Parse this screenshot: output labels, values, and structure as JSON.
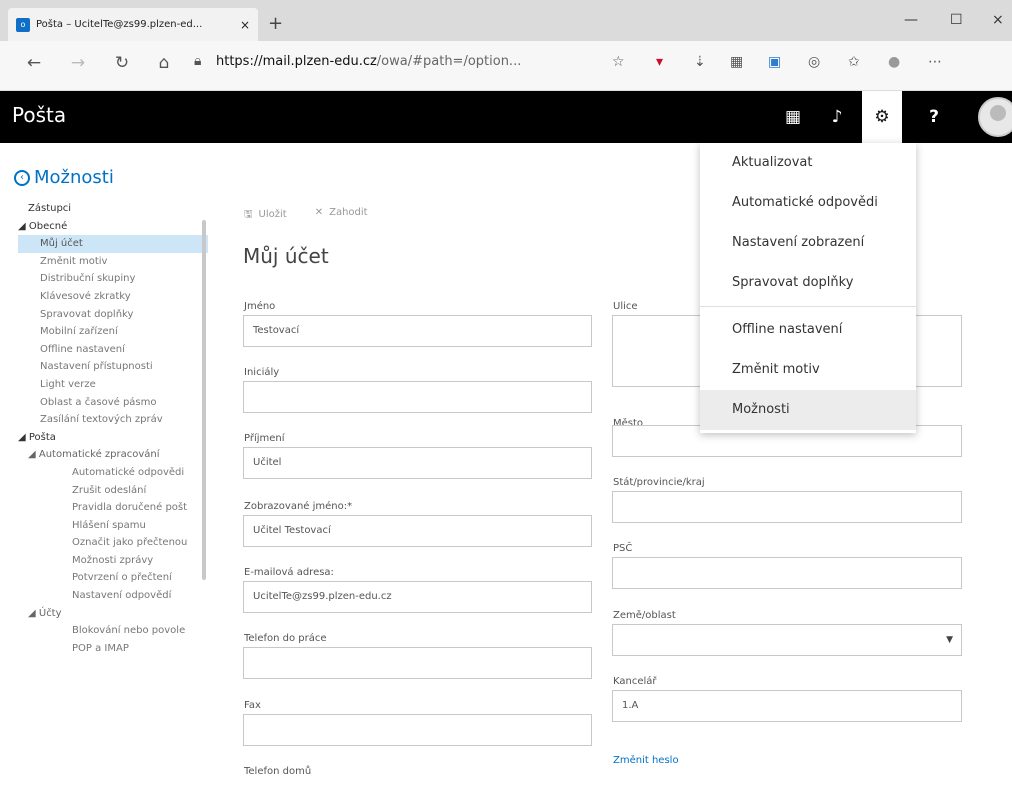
{
  "browser": {
    "tab_favicon": "o",
    "tab_title": "Pošta – UcitelTe@zs99.plzen-ed...",
    "tab_close": "×",
    "new_tab": "+",
    "url_host": "https://mail.plzen-edu.cz",
    "url_path": "/owa/#path=/option...",
    "win_min": "—",
    "win_max": "☐",
    "win_close": "×"
  },
  "header": {
    "app_name": "Pošta"
  },
  "sidebar": {
    "back_label": "Možnosti",
    "items": [
      {
        "label": "Zástupci",
        "level": "l0"
      },
      {
        "label": "◢ Obecné",
        "level": "h"
      },
      {
        "label": "Můj účet",
        "level": "l1",
        "selected": true
      },
      {
        "label": "Změnit motiv",
        "level": "l1"
      },
      {
        "label": "Distribuční skupiny",
        "level": "l1"
      },
      {
        "label": "Klávesové zkratky",
        "level": "l1"
      },
      {
        "label": "Spravovat doplňky",
        "level": "l1"
      },
      {
        "label": "Mobilní zařízení",
        "level": "l1"
      },
      {
        "label": "Offline nastavení",
        "level": "l1"
      },
      {
        "label": "Nastavení přístupnosti",
        "level": "l1"
      },
      {
        "label": "Light verze",
        "level": "l1"
      },
      {
        "label": "Oblast a časové pásmo",
        "level": "l1"
      },
      {
        "label": "Zasílání textových zpráv",
        "level": "l1"
      },
      {
        "label": "◢ Pošta",
        "level": "h"
      },
      {
        "label": "◢ Automatické zpracování",
        "level": "l1h"
      },
      {
        "label": "Automatické odpovědi",
        "level": "l3"
      },
      {
        "label": "Zrušit odeslání",
        "level": "l3"
      },
      {
        "label": "Pravidla doručené pošt",
        "level": "l3"
      },
      {
        "label": "Hlášení spamu",
        "level": "l3"
      },
      {
        "label": "Označit jako přečtenou",
        "level": "l3"
      },
      {
        "label": "Možnosti zprávy",
        "level": "l3"
      },
      {
        "label": "Potvrzení o přečtení",
        "level": "l3"
      },
      {
        "label": "Nastavení odpovědí",
        "level": "l3"
      },
      {
        "label": "◢ Účty",
        "level": "l1h"
      },
      {
        "label": "Blokování nebo povole",
        "level": "l3"
      },
      {
        "label": "POP a IMAP",
        "level": "l3"
      }
    ]
  },
  "toolbar": {
    "save_label": "Uložit",
    "discard_label": "Zahodit"
  },
  "form": {
    "title": "Můj účet",
    "left": [
      {
        "label": "Jméno",
        "value": ""
      },
      {
        "label": "Iniciály",
        "value": ""
      },
      {
        "label": "Příjmení",
        "value": "Učitel"
      },
      {
        "label": "Zobrazované jméno:*",
        "value": "Učitel Testovací"
      },
      {
        "label": "E-mailová adresa:",
        "value": "UcitelTe@zs99.plzen-edu.cz"
      },
      {
        "label": "Telefon do práce",
        "value": ""
      },
      {
        "label": "Fax",
        "value": ""
      },
      {
        "label": "Telefon domů",
        "value": ""
      }
    ],
    "first_name_value": "Testovací",
    "right": [
      {
        "label": "Ulice",
        "value": ""
      },
      {
        "label": "Město",
        "value": ""
      },
      {
        "label": "Stát/provincie/kraj",
        "value": ""
      },
      {
        "label": "PSČ",
        "value": ""
      },
      {
        "label": "Země/oblast",
        "value": ""
      },
      {
        "label": "Kancelář",
        "value": "1.A"
      }
    ],
    "change_password": "Změnit heslo"
  },
  "menu": {
    "items": [
      "Aktualizovat",
      "Automatické odpovědi",
      "Nastavení zobrazení",
      "Spravovat doplňky",
      "Offline nastavení",
      "Změnit motiv",
      "Možnosti"
    ]
  }
}
